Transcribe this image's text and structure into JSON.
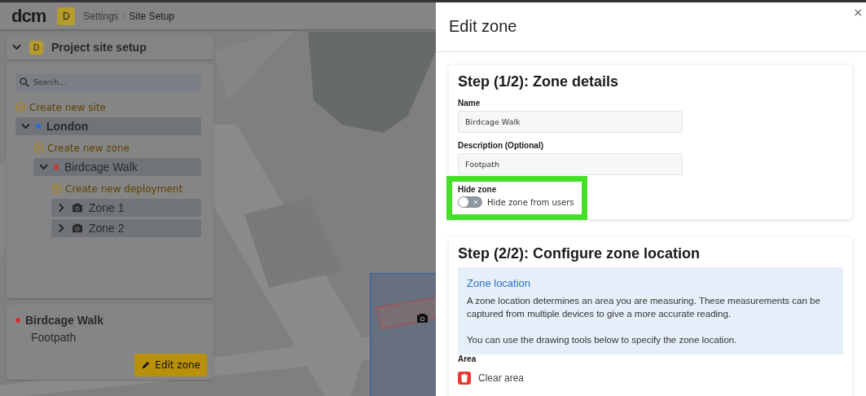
{
  "header": {
    "logo": "dcm",
    "avatar": "D",
    "breadcrumb": [
      "Settings",
      "Site Setup"
    ]
  },
  "sidebar": {
    "title": "Project site setup",
    "avatar": "D",
    "expanded": true,
    "search": {
      "placeholder": "Search..."
    },
    "create_site": "Create new site",
    "tree": [
      {
        "label": "London",
        "color": "#1e6fd9",
        "expanded": true,
        "action": "Create new zone",
        "children": [
          {
            "label": "Birdcage Walk",
            "color": "#d32f2f",
            "expanded": true,
            "action": "Create new deployment",
            "children": [
              {
                "label": "Zone 1",
                "expanded": false
              },
              {
                "label": "Zone 2",
                "expanded": false
              }
            ]
          }
        ]
      }
    ]
  },
  "detail": {
    "name": "Birdcage Walk",
    "color": "#d32f2f",
    "description": "Footpath",
    "button": "Edit zone"
  },
  "drawer": {
    "title": "Edit zone",
    "close": "×",
    "step1": {
      "heading": "Step (1/2): Zone details",
      "fields": [
        {
          "label": "Name",
          "value": "Birdcage Walk"
        },
        {
          "label": "Description (Optional)",
          "value": "Footpath"
        }
      ],
      "hide": {
        "label": "Hide zone",
        "text": "Hide zone from users",
        "on": false,
        "highlighted": true
      }
    },
    "step2": {
      "heading": "Step (2/2): Configure zone location",
      "info": {
        "title": "Zone location",
        "paragraphs": [
          "A zone location determines an area you are measuring. These measurements can be captured from multiple devices to give a more accurate reading.",
          "You can use the drawing tools below to specify the zone location."
        ]
      },
      "area_label": "Area",
      "clear": "Clear area"
    }
  }
}
